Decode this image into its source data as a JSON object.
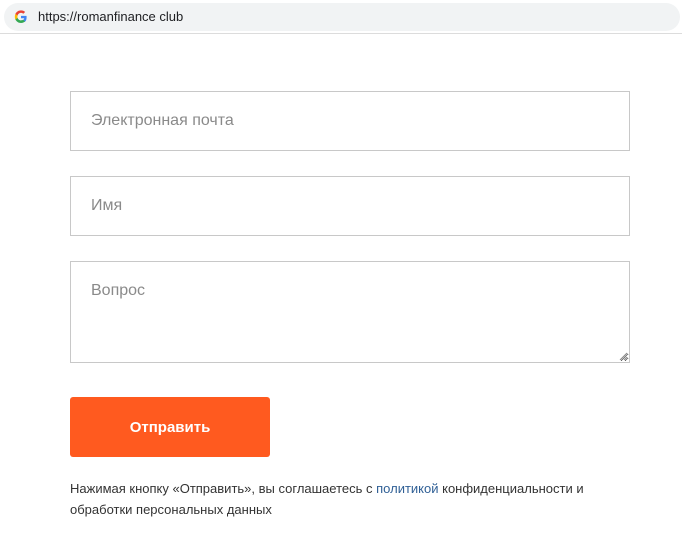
{
  "browser": {
    "url": "https://romanfinance club",
    "favicon": "google-g-icon"
  },
  "form": {
    "email_placeholder": "Электронная почта",
    "name_placeholder": "Имя",
    "question_placeholder": "Вопрос",
    "submit_label": "Отправить",
    "consent_before": "Нажимая кнопку «Отправить», вы соглашаетесь с ",
    "consent_link": "политикой",
    "consent_after": " конфиденциальности и обработки персональных данных"
  },
  "colors": {
    "button": "#ff5a1f",
    "link": "#2f5f95",
    "border": "#c8c8c8"
  }
}
